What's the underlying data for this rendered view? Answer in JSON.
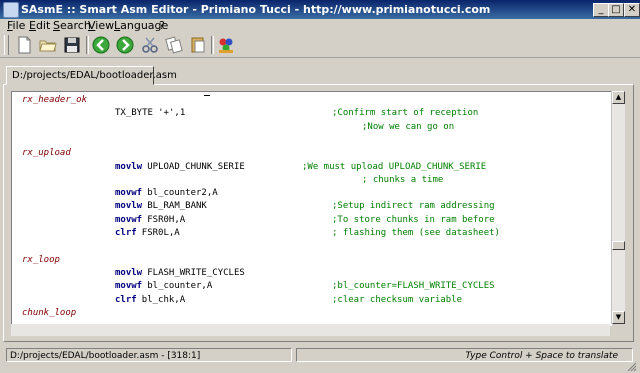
{
  "window": {
    "title": "SAsmE :: Smart Asm Editor - Primiano Tucci - http://www.primianotucci.com",
    "controls": {
      "minimize": "_",
      "maximize": "□",
      "close": "✕"
    }
  },
  "menu": [
    {
      "label": "File",
      "mnemonic": "F"
    },
    {
      "label": "Edit",
      "mnemonic": "E"
    },
    {
      "label": "Search",
      "mnemonic": "S"
    },
    {
      "label": "View",
      "mnemonic": "V"
    },
    {
      "label": "Language",
      "mnemonic": "L"
    },
    {
      "label": "?",
      "mnemonic": ""
    }
  ],
  "toolbar": [
    {
      "name": "new-file-icon"
    },
    {
      "name": "open-folder-icon"
    },
    {
      "name": "save-disk-icon"
    },
    {
      "name": "back-arrow-icon"
    },
    {
      "name": "forward-arrow-icon"
    },
    {
      "name": "cut-scissors-icon"
    },
    {
      "name": "copy-icon"
    },
    {
      "name": "paste-icon"
    },
    {
      "name": "tools-icon"
    }
  ],
  "tab": {
    "label": "D:/projects/EDAL/bootloader.asm"
  },
  "editor": {
    "lines": [
      {
        "label": "rx_header_ok"
      },
      {
        "instr": "TX_BYTE",
        "operand": "'+',1",
        "comment": ";Confirm start of reception"
      },
      {
        "comment": ";Now we can go on"
      },
      {
        "blank": true
      },
      {
        "label": "rx_upload"
      },
      {
        "instr": "movlw",
        "operand": "UPLOAD_CHUNK_SERIE",
        "comment": ";We must upload UPLOAD_CHUNK_SERIE"
      },
      {
        "comment": "; chunks a time"
      },
      {
        "instr": "movwf",
        "operand": "bl_counter2,A"
      },
      {
        "instr": "movlw",
        "operand": "BL_RAM_BANK",
        "comment": ";Setup indirect ram addressing"
      },
      {
        "instr": "movwf",
        "operand": "FSR0H,A",
        "comment": ";To store chunks in ram before"
      },
      {
        "instr": "clrf",
        "operand": "FSR0L,A",
        "comment": "; flashing them (see datasheet)"
      },
      {
        "blank": true
      },
      {
        "label": "rx_loop"
      },
      {
        "instr": "movlw",
        "operand": "FLASH_WRITE_CYCLES"
      },
      {
        "instr": "movwf",
        "operand": "bl_counter,A",
        "comment": ";bl_counter=FLASH_WRITE_CYCLES"
      },
      {
        "instr": "clrf",
        "operand": "bl_chk,A",
        "comment": ";clear checksum variable"
      },
      {
        "label": "chunk_loop"
      }
    ]
  },
  "status": {
    "left": "D:/projects/EDAL/bootloader.asm - [318:1]",
    "right": "Type Control + Space to translate"
  },
  "colors": {
    "label": "#800000",
    "instruction": "#000080",
    "comment": "#008000",
    "titlebar": "#0a246a"
  }
}
